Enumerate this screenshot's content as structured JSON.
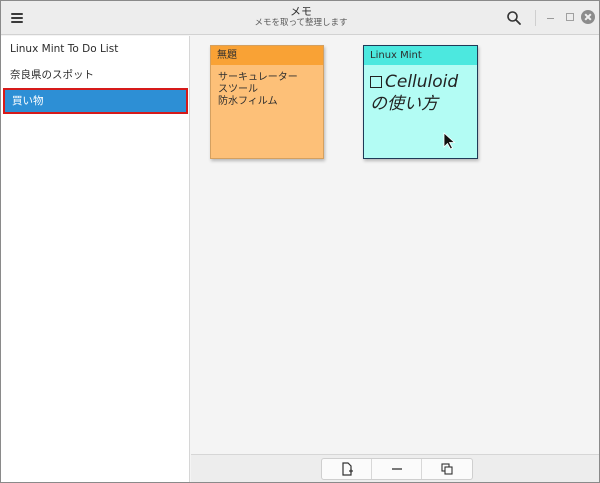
{
  "window": {
    "title": "メモ",
    "subtitle": "メモを取って整理します"
  },
  "header": {
    "menu_icon": "hamburger-menu-icon",
    "search_icon": "search-icon",
    "window_controls": [
      "minimize-icon",
      "maximize-icon",
      "close-icon"
    ]
  },
  "sidebar": {
    "items": [
      {
        "label": "Linux Mint To Do List",
        "selected": false
      },
      {
        "label": "奈良県のスポット",
        "selected": false
      },
      {
        "label": "買い物",
        "selected": true
      }
    ],
    "selected_color": "#2d8fd5",
    "highlight_color": "#d61a1a"
  },
  "notes": [
    {
      "title": "無題",
      "lines": [
        "サーキュレーター",
        "スツール",
        "防水フィルム"
      ],
      "header_color": "#f9a235",
      "body_color": "#fdc078"
    },
    {
      "title": "Linux Mint",
      "checkbox": true,
      "lines": [
        "Celluloid",
        "の使い方"
      ],
      "header_color": "#4ce8df",
      "body_color": "#b3fcf4"
    }
  ],
  "toolbar": {
    "buttons": [
      "new-note-icon",
      "remove-note-icon",
      "duplicate-note-icon"
    ]
  }
}
